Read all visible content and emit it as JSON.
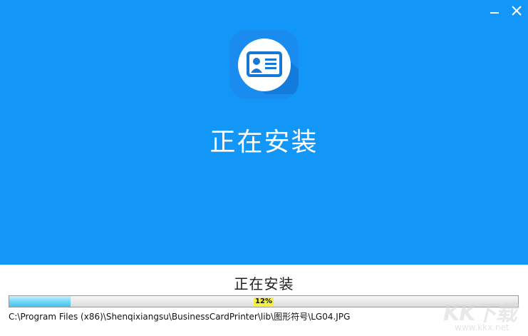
{
  "window": {
    "minimize_icon": "minimize-icon",
    "close_icon": "close-icon"
  },
  "header": {
    "title": "正在安装",
    "app_icon": "business-card-icon",
    "background_color": "#1296f7"
  },
  "status": {
    "label": "正在安装"
  },
  "progress": {
    "percent": 12,
    "text": "12%"
  },
  "current_file": "C:\\Program Files (x86)\\Shenqixiangsu\\BusinessCardPrinter\\lib\\图形符号\\LG04.JPG",
  "watermark": {
    "main": "KK下载",
    "sub": "www.kkx.net"
  }
}
